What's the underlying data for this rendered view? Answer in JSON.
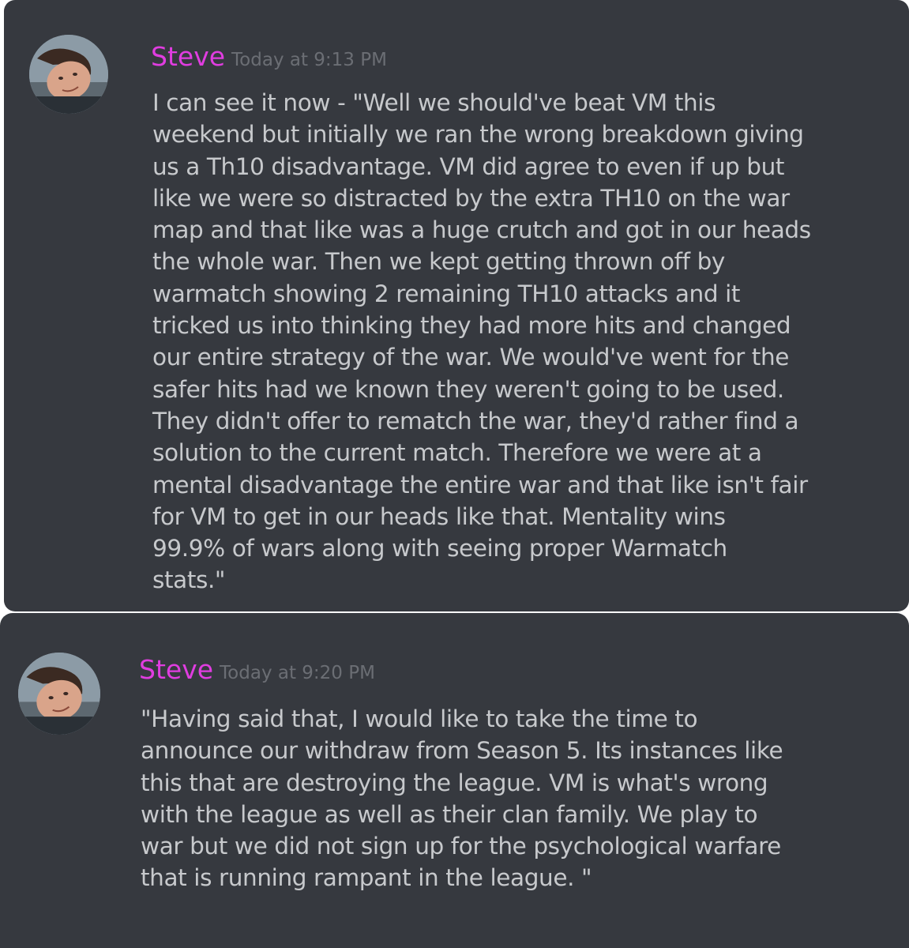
{
  "messages": [
    {
      "username": "Steve",
      "timestamp": "Today at 9:13 PM",
      "text": "I can see it now - \"Well we should've beat VM this\nweekend but initially we ran the wrong breakdown giving\nus a Th10 disadvantage.  VM did agree to even if up but\nlike we were so distracted by the extra TH10 on the war\nmap and that like was a huge crutch and got in our heads\nthe whole war.  Then we kept getting thrown off by\nwarmatch showing 2 remaining TH10 attacks and it\ntricked us into thinking they had more hits and changed\nour entire strategy of the war.  We would've went for the\nsafer hits had we known they weren't going to be used.\nThey didn't offer to rematch the war, they'd rather find a\nsolution to the current match.  Therefore we were at a\nmental disadvantage the entire war and that like isn't fair\nfor VM to get in our heads like that.  Mentality wins\n99.9% of wars along with seeing proper Warmatch\nstats.\""
    },
    {
      "username": "Steve",
      "timestamp": "Today at 9:20 PM",
      "text": "\"Having said that, I would like to take the time to\nannounce our withdraw from Season 5.  Its instances like\nthis that are destroying the league.  VM is what's wrong\nwith the league as well as their clan family.  We play to\nwar but we did not sign up for the psychological warfare\nthat is running rampant in the league.  \""
    }
  ],
  "colors": {
    "background": "#36393f",
    "username": "#e03de0",
    "timestamp": "#6b6e74",
    "text": "#c7c9cc"
  }
}
